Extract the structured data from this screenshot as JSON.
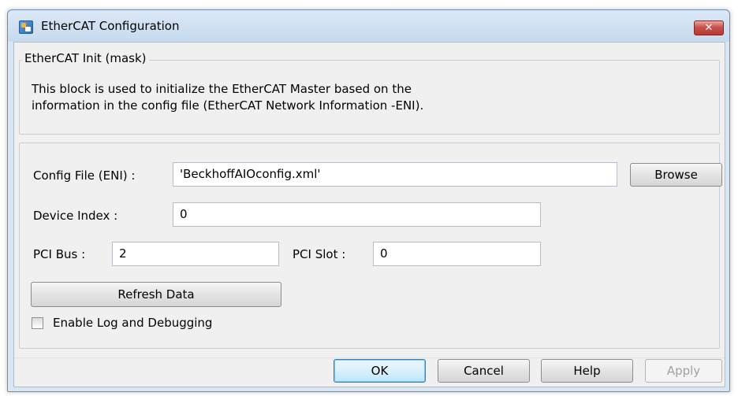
{
  "window": {
    "title": "EtherCAT Configuration",
    "close_glyph": "✕"
  },
  "mask": {
    "group_label": "EtherCAT Init (mask)",
    "description_line1": "This block is used to initialize the EtherCAT Master based on the",
    "description_line2": "information in the config file (EtherCAT Network Information -ENI)."
  },
  "params": {
    "config_file": {
      "label": "Config File (ENI) :",
      "value": "'BeckhoffAIOconfig.xml'"
    },
    "browse_label": "Browse",
    "device_index": {
      "label": "Device Index :",
      "value": "0"
    },
    "pci_bus": {
      "label": "PCI Bus :",
      "value": "2"
    },
    "pci_slot": {
      "label": "PCI Slot :",
      "value": "0"
    },
    "refresh_label": "Refresh Data",
    "enable_log": {
      "label": "Enable Log and Debugging",
      "checked": false
    }
  },
  "footer": {
    "ok_label": "OK",
    "cancel_label": "Cancel",
    "help_label": "Help",
    "apply_label": "Apply"
  },
  "colors": {
    "title_bar": "#c7daee",
    "close_button": "#c75050",
    "dialog_background": "#f0f0f0",
    "default_button_border": "#3c7fb1"
  }
}
